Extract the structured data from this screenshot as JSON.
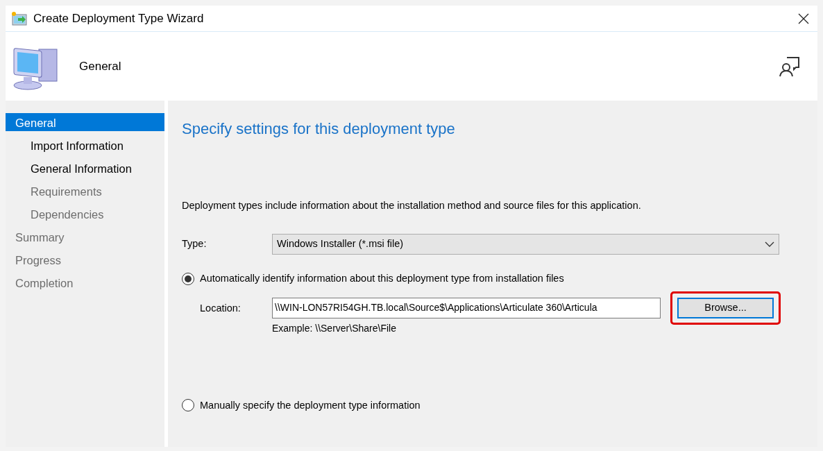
{
  "window": {
    "title": "Create Deployment Type Wizard"
  },
  "header": {
    "title": "General"
  },
  "sidebar": {
    "items": [
      {
        "label": "General",
        "selected": true,
        "disabled": false,
        "children": [
          {
            "label": "Import Information",
            "selected": false,
            "disabled": false
          },
          {
            "label": "General Information",
            "selected": false,
            "disabled": false
          },
          {
            "label": "Requirements",
            "selected": false,
            "disabled": true
          },
          {
            "label": "Dependencies",
            "selected": false,
            "disabled": true
          }
        ]
      },
      {
        "label": "Summary",
        "selected": false,
        "disabled": true
      },
      {
        "label": "Progress",
        "selected": false,
        "disabled": true
      },
      {
        "label": "Completion",
        "selected": false,
        "disabled": true
      }
    ]
  },
  "content": {
    "heading": "Specify settings for this deployment type",
    "description": "Deployment types include information about the installation method and source files for this application.",
    "type_label": "Type:",
    "type_value": "Windows Installer (*.msi file)",
    "auto_option": {
      "label": "Automatically identify information about this deployment type from installation files",
      "selected": true
    },
    "location_label": "Location:",
    "location_value": "\\\\WIN-LON57RI54GH.TB.local\\Source$\\Applications\\Articulate 360\\Articula",
    "example": "Example: \\\\Server\\Share\\File",
    "browse_button": {
      "label": "Browse...",
      "highlighted": true
    },
    "manual_option": {
      "label": "Manually specify the deployment type information",
      "selected": false
    }
  }
}
